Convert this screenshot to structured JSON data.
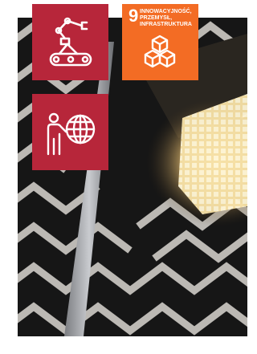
{
  "photo": {
    "subject": "street-lamp-photo"
  },
  "tiles": {
    "robot": {
      "icon": "robot-arm-conveyor-icon",
      "color": "#b7263a"
    },
    "globe": {
      "icon": "person-globe-icon",
      "color": "#b7263a"
    },
    "sdg9": {
      "number": "9",
      "title": "INNOWACYJNOŚĆ, PRZEMYSŁ, INFRASTRUKTURA",
      "icon": "cubes-icon",
      "color": "#f36c24"
    }
  }
}
